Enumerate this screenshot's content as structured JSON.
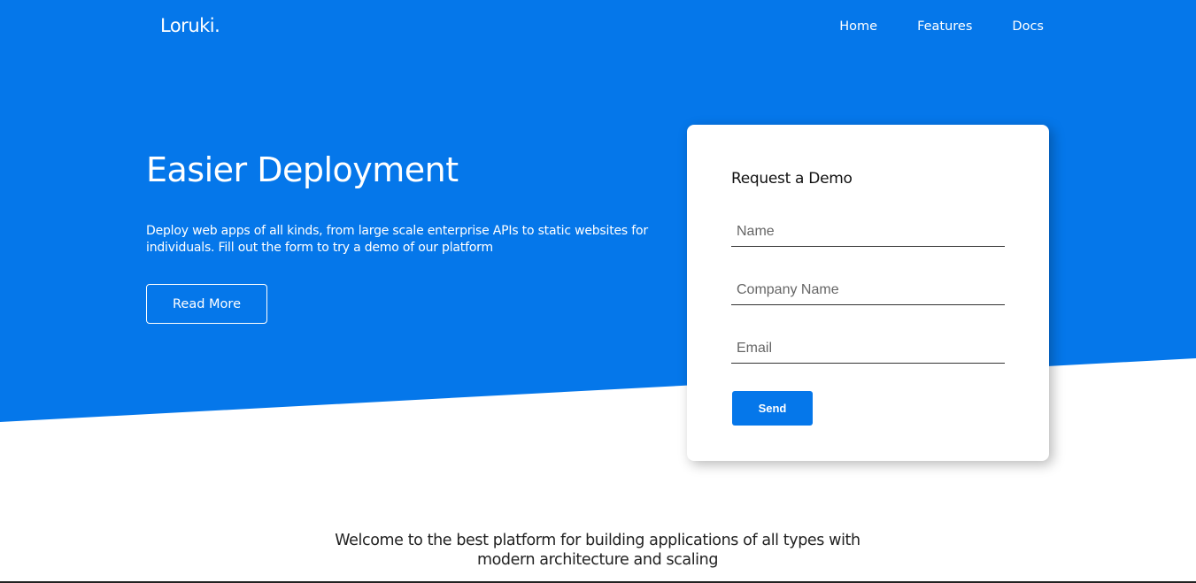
{
  "brand": {
    "logo": "Loruki.",
    "accent_color": "#0577ea"
  },
  "nav": {
    "items": [
      {
        "label": "Home"
      },
      {
        "label": "Features"
      },
      {
        "label": "Docs"
      }
    ]
  },
  "hero": {
    "title": "Easier Deployment",
    "description": "Deploy web apps of all kinds, from large scale enterprise APIs to static websites for individuals. Fill out the form to try a demo of our platform",
    "read_more_label": "Read More"
  },
  "demo_form": {
    "title": "Request a Demo",
    "name_placeholder": "Name",
    "company_placeholder": "Company Name",
    "email_placeholder": "Email",
    "send_label": "Send"
  },
  "welcome": {
    "text": "Welcome to the best platform for building applications of all types with modern architecture and scaling"
  }
}
